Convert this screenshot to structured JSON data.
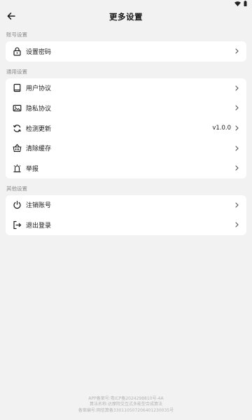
{
  "status_bar": {
    "icons": [
      "wifi-icon",
      "battery-icon"
    ]
  },
  "header": {
    "title": "更多设置",
    "back_icon": "arrow-left-icon"
  },
  "sections": {
    "account": {
      "label": "账号设置",
      "items": [
        {
          "label": "设置密码",
          "icon": "lock-icon"
        }
      ]
    },
    "general": {
      "label": "通用设置",
      "items": [
        {
          "label": "用户协议",
          "icon": "book-icon"
        },
        {
          "label": "隐私协议",
          "icon": "image-shield-icon"
        },
        {
          "label": "检测更新",
          "icon": "refresh-icon",
          "value": "v1.0.0"
        },
        {
          "label": "清除缓存",
          "icon": "basket-icon"
        },
        {
          "label": "举报",
          "icon": "report-icon"
        }
      ]
    },
    "other": {
      "label": "其他设置",
      "items": [
        {
          "label": "注销账号",
          "icon": "power-icon"
        },
        {
          "label": "退出登录",
          "icon": "logout-icon"
        }
      ]
    }
  },
  "footer": {
    "line1": "APP备案号:粤ICP备2024298810号-4A",
    "line2": "算法名称:达摩院交互式多能型合成算法",
    "line3": "备案编号:网信算备330110507206401230035号"
  },
  "colors": {
    "background": "#f2f2f2",
    "card": "#ffffff",
    "text": "#1a1a1a",
    "muted": "#8a8a8a"
  }
}
